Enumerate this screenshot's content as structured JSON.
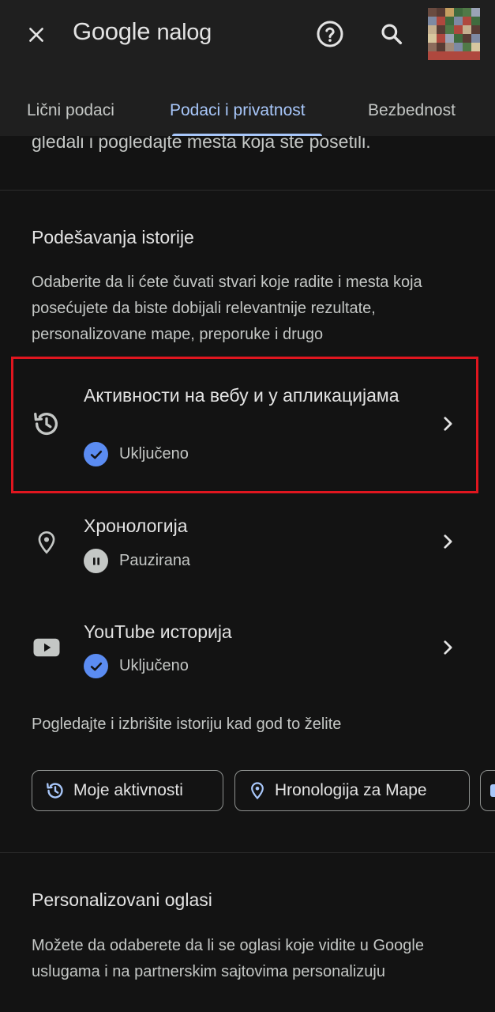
{
  "header": {
    "title_brand": "Google",
    "title_suffix": "nalog"
  },
  "tabs": [
    {
      "label": "Lični podaci"
    },
    {
      "label": "Podaci i privatnost"
    },
    {
      "label": "Bezbednost"
    }
  ],
  "clipped_text": "gledali i pogledajte mesta koja ste posetili.",
  "history": {
    "title": "Podešavanja istorije",
    "description": "Odaberite da li ćete čuvati stvari koje radite i mesta koja posećujete da biste dobijali relevantnije rezultate, personalizovane mape, preporuke i drugo",
    "items": [
      {
        "title": "Активности на вебу и у апликацијама",
        "status": "Uključeno",
        "icon": "history-icon"
      },
      {
        "title": "Хронологија",
        "status": "Pauzirana",
        "icon": "location-pin-icon"
      },
      {
        "title": "YouTube историја",
        "status": "Uključeno",
        "icon": "youtube-icon"
      }
    ],
    "footer_text": "Pogledajte i izbrišite istoriju kad god to želite",
    "chips": [
      {
        "label": "Moje aktivnosti",
        "icon": "history-icon"
      },
      {
        "label": "Hronologija za Mape",
        "icon": "location-pin-icon"
      }
    ]
  },
  "ads": {
    "title": "Personalizovani oglasi",
    "description": "Možete da odaberete da li se oglasi koje vidite u Google uslugama i na partnerskim sajtovima personalizuju"
  },
  "colors": {
    "background": "#131313",
    "topbar": "#1f1f1f",
    "accent": "#a8c7fa",
    "status_on": "#5b8cf2",
    "highlight": "#e0161f"
  }
}
